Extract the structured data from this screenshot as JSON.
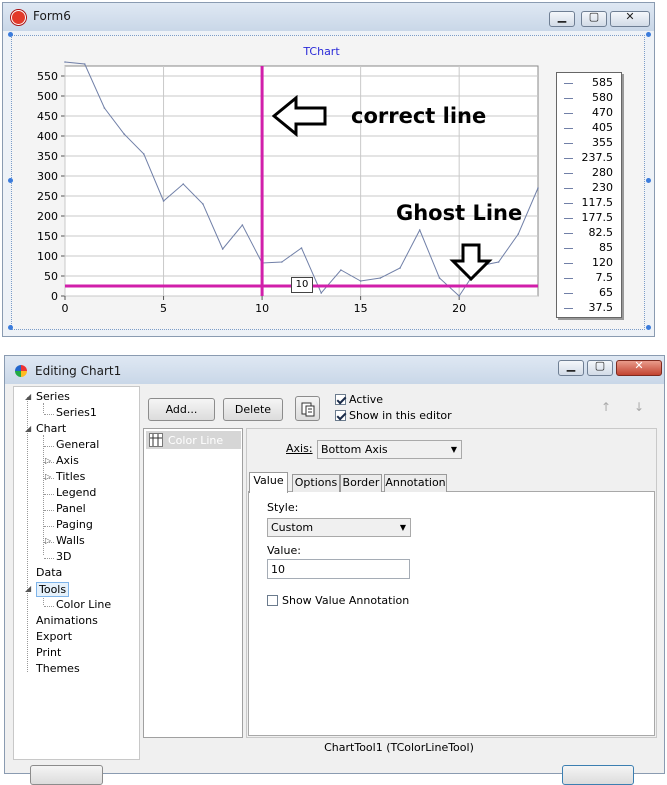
{
  "form": {
    "title": "Form6",
    "controls": {
      "min": "▁",
      "max": "▢",
      "close": "✕"
    }
  },
  "chart": {
    "title": "TChart",
    "annotation_correct": "correct line",
    "annotation_ghost": "Ghost Line",
    "colorline_label": "10",
    "legend": [
      "585",
      "580",
      "470",
      "405",
      "355",
      "237.5",
      "280",
      "230",
      "117.5",
      "177.5",
      "82.5",
      "85",
      "120",
      "7.5",
      "65",
      "37.5"
    ]
  },
  "chart_data": {
    "type": "line",
    "title": "TChart",
    "x": [
      0,
      1,
      2,
      3,
      4,
      5,
      6,
      7,
      8,
      9,
      10,
      11,
      12,
      13,
      14,
      15,
      16,
      17,
      18,
      19,
      20,
      21,
      22,
      23,
      24
    ],
    "y": [
      585,
      580,
      470,
      405,
      355,
      237.5,
      280,
      230,
      117.5,
      177.5,
      82.5,
      85,
      120,
      7.5,
      65,
      37.5,
      45,
      70,
      165,
      45,
      0,
      75,
      85,
      155,
      270
    ],
    "xlim": [
      0,
      24
    ],
    "ylim": [
      0,
      575
    ],
    "xticks": [
      "0",
      "5",
      "10",
      "15",
      "20"
    ],
    "yticks": [
      "0",
      "50",
      "100",
      "150",
      "200",
      "250",
      "300",
      "350",
      "400",
      "450",
      "500",
      "550"
    ],
    "vertical_line_x": 10,
    "horizontal_line_y": 25,
    "grid": true,
    "legend_placement": "right",
    "series_color": "#7180a8",
    "tool_line_color": "#d11faa"
  },
  "editor": {
    "title": "Editing Chart1",
    "controls": {
      "min": "▁",
      "max": "▢",
      "close": "✕"
    },
    "tree": [
      {
        "label": "Series",
        "indent": 0,
        "expanded": true
      },
      {
        "label": "Series1",
        "indent": 1
      },
      {
        "label": "Chart",
        "indent": 0,
        "expanded": true
      },
      {
        "label": "General",
        "indent": 1
      },
      {
        "label": "Axis",
        "indent": 1,
        "collapsed": true
      },
      {
        "label": "Titles",
        "indent": 1,
        "collapsed": true
      },
      {
        "label": "Legend",
        "indent": 1
      },
      {
        "label": "Panel",
        "indent": 1
      },
      {
        "label": "Paging",
        "indent": 1
      },
      {
        "label": "Walls",
        "indent": 1,
        "collapsed": true
      },
      {
        "label": "3D",
        "indent": 1
      },
      {
        "label": "Data",
        "indent": 0
      },
      {
        "label": "Tools",
        "indent": 0,
        "expanded": true,
        "selected": true
      },
      {
        "label": "Color Line",
        "indent": 1
      },
      {
        "label": "Animations",
        "indent": 0
      },
      {
        "label": "Export",
        "indent": 0
      },
      {
        "label": "Print",
        "indent": 0
      },
      {
        "label": "Themes",
        "indent": 0
      }
    ],
    "toolbar": {
      "add_label": "Add...",
      "delete_label": "Delete",
      "active_label": "Active",
      "show_label": "Show in this editor",
      "up_icon": "↑",
      "down_icon": "↓"
    },
    "tool_list": [
      "Color Line"
    ],
    "axis_label": "Axis:",
    "axis_value": "Bottom Axis",
    "tabs": [
      "Value",
      "Options",
      "Border",
      "Annotation"
    ],
    "style_label": "Style:",
    "style_value": "Custom",
    "value_label": "Value:",
    "value_value": "10",
    "show_value_annotation": "Show Value Annotation",
    "status": "ChartTool1 (TColorLineTool)"
  }
}
